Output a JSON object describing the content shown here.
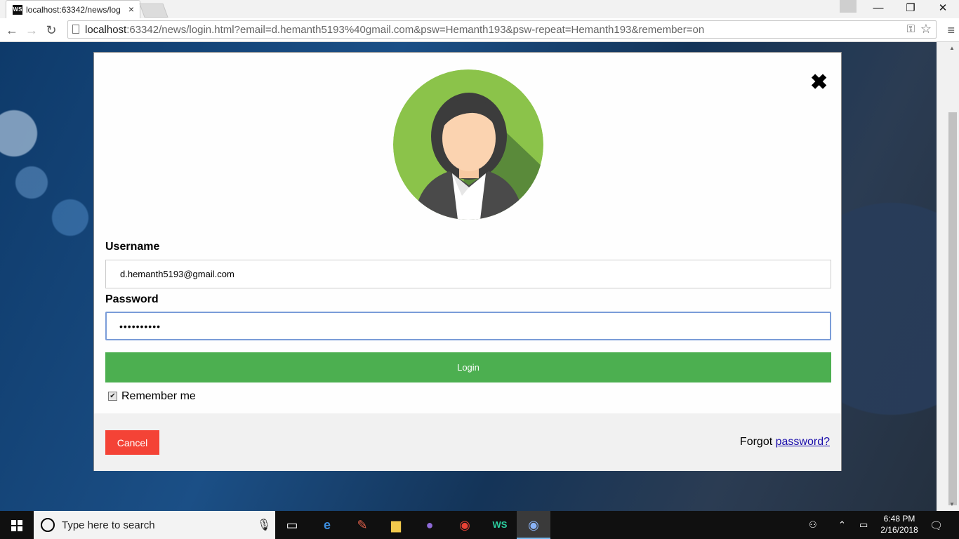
{
  "browser": {
    "tab_title": "localhost:63342/news/log",
    "favicon_text": "WS",
    "url_host": "localhost",
    "url_rest": ":63342/news/login.html?email=d.hemanth5193%40gmail.com&psw=Hemanth193&psw-repeat=Hemanth193&remember=on"
  },
  "modal": {
    "close_glyph": "✖",
    "username_label": "Username",
    "username_value": "d.hemanth5193@gmail.com",
    "password_label": "Password",
    "password_masked": "••••••••••",
    "login_label": "Login",
    "remember_label": "Remember me",
    "remember_checked": true,
    "cancel_label": "Cancel",
    "forgot_prefix": "Forgot",
    "forgot_link": "password?"
  },
  "colors": {
    "login_green": "#4caf50",
    "cancel_red": "#f44336",
    "avatar_green": "#8bc34a",
    "link_blue": "#1a0dab"
  },
  "taskbar": {
    "search_placeholder": "Type here to search",
    "time": "6:48 PM",
    "date": "2/16/2018",
    "icons": [
      "task-view-icon",
      "edge-icon",
      "paint-icon",
      "file-explorer-icon",
      "github-icon",
      "chrome-icon",
      "webstorm-icon",
      "chrome-active-icon"
    ]
  }
}
